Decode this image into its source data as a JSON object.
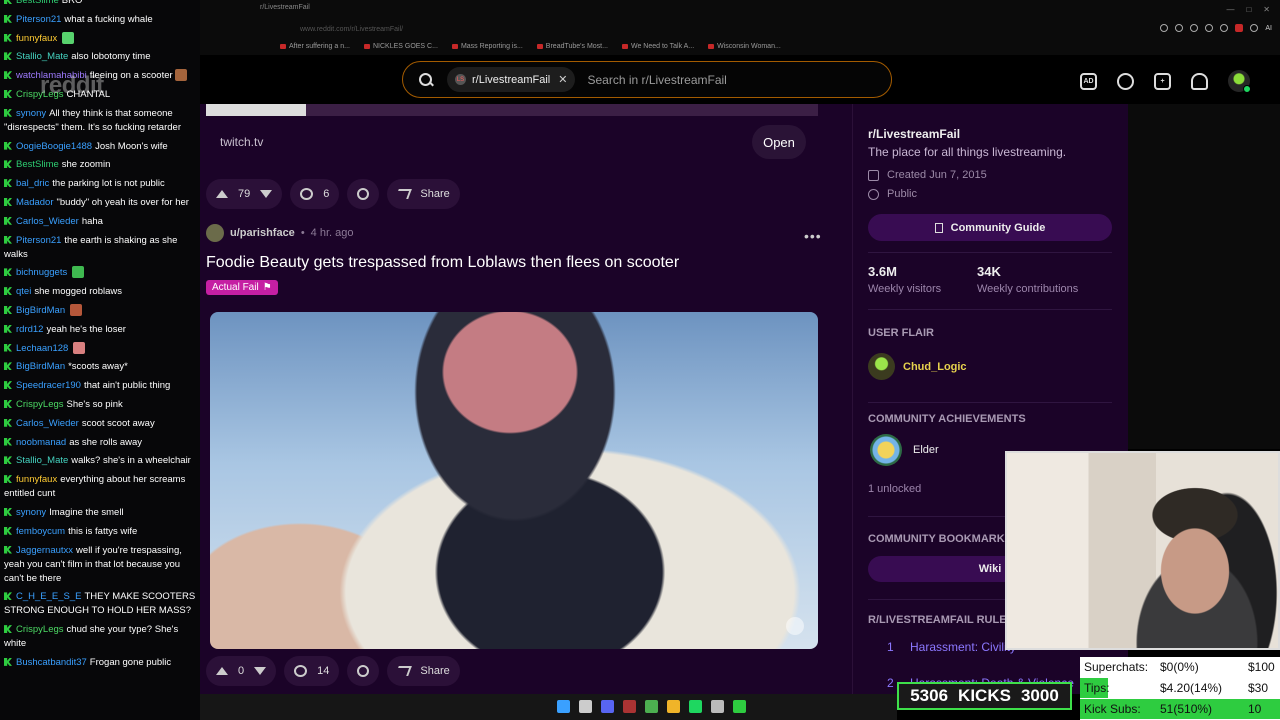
{
  "chat": {
    "messages": [
      {
        "user": "BestSlime",
        "color": "#2ecc71",
        "text": "BRO"
      },
      {
        "user": "Piterson21",
        "color": "#3aa0ff",
        "text": "what a fucking whale"
      },
      {
        "user": "funnyfaux",
        "color": "#ffcc33",
        "text": "",
        "emote": "#58d26e"
      },
      {
        "user": "Stallio_Mate",
        "color": "#45d3c0",
        "text": "also lobotomy time"
      },
      {
        "user": "watchlamahabibi",
        "color": "#9f7bff",
        "text": "fleeing on a scooter",
        "emote": "#a4643c"
      },
      {
        "user": "CrispyLegs",
        "color": "#4cd964",
        "text": "CHANTAL"
      },
      {
        "user": "synony",
        "color": "#3aa0ff",
        "text": "All they think is that someone \"disrespects\" them. It's so fucking retarder"
      },
      {
        "user": "OogieBoogie1488",
        "color": "#3aa0ff",
        "text": "Josh Moon's wife"
      },
      {
        "user": "BestSlime",
        "color": "#2ecc71",
        "text": "she zoomin"
      },
      {
        "user": "bal_dric",
        "color": "#3aa0ff",
        "text": "the parking lot is not public"
      },
      {
        "user": "Madador",
        "color": "#3aa0ff",
        "text": "\"buddy\" oh yeah its over for her"
      },
      {
        "user": "Carlos_Wieder",
        "color": "#3aa0ff",
        "text": "haha"
      },
      {
        "user": "Piterson21",
        "color": "#3aa0ff",
        "text": "the earth is shaking as she walks"
      },
      {
        "user": "bichnuggets",
        "color": "#3aa0ff",
        "text": "",
        "emote": "#3fb950"
      },
      {
        "user": "qtei",
        "color": "#3aa0ff",
        "text": "she mogged roblaws"
      },
      {
        "user": "BigBirdMan",
        "color": "#3aa0ff",
        "text": "",
        "emote": "#b5573a"
      },
      {
        "user": "rdrd12",
        "color": "#3aa0ff",
        "text": "yeah he's the loser"
      },
      {
        "user": "Lechaan128",
        "color": "#3aa0ff",
        "text": "",
        "emote": "#d98080"
      },
      {
        "user": "BigBirdMan",
        "color": "#3aa0ff",
        "text": "*scoots away*"
      },
      {
        "user": "Speedracer190",
        "color": "#3aa0ff",
        "text": "that ain't public thing"
      },
      {
        "user": "CrispyLegs",
        "color": "#4cd964",
        "text": "She's so pink"
      },
      {
        "user": "Carlos_Wieder",
        "color": "#3aa0ff",
        "text": "scoot scoot away"
      },
      {
        "user": "noobmanad",
        "color": "#3aa0ff",
        "text": "as she rolls away"
      },
      {
        "user": "Stallio_Mate",
        "color": "#45d3c0",
        "text": "walks? she's in a wheelchair"
      },
      {
        "user": "funnyfaux",
        "color": "#ffcc33",
        "text": "everything about her screams entitled cunt"
      },
      {
        "user": "synony",
        "color": "#3aa0ff",
        "text": "Imagine the smell"
      },
      {
        "user": "femboycum",
        "color": "#3aa0ff",
        "text": "this is fattys wife"
      },
      {
        "user": "Jaggernautxx",
        "color": "#3aa0ff",
        "text": "well if you're trespassing, yeah you can't film in that lot because you can't be there"
      },
      {
        "user": "C_H_E_E_S_E",
        "color": "#3aa0ff",
        "text": "THEY MAKE SCOOTERS STRONG ENOUGH TO HOLD HER MASS?"
      },
      {
        "user": "CrispyLegs",
        "color": "#4cd964",
        "text": "chud she your type? She's white"
      },
      {
        "user": "Bushcatbandit37",
        "color": "#3aa0ff",
        "text": "Frogan gone public"
      }
    ]
  },
  "browser": {
    "tab_title": "r/LivestreamFail",
    "url": "www.reddit.com/r/LivestreamFail/",
    "bookmarks": [
      "After suffering a n...",
      "NICKLES GOES C...",
      "Mass Reporting is...",
      "BreadTube's Most...",
      "We Need to Talk A...",
      "Wisconsin Woman..."
    ],
    "ext_ai_label": "AI"
  },
  "header": {
    "logo": "reddit",
    "community_chip": "r/LivestreamFail",
    "chip_icon": "LS",
    "search_placeholder": "Search in r/LivestreamFail",
    "icons": [
      "advertise-icon",
      "chat-icon",
      "create-post-icon",
      "notifications-icon"
    ],
    "ad_label": "AD"
  },
  "post1": {
    "link": "twitch.tv",
    "open_label": "Open",
    "votes": "79",
    "comments": "6",
    "share_label": "Share"
  },
  "post2": {
    "author": "u/parishface",
    "time": "4 hr. ago",
    "title": "Foodie Beauty gets trespassed from Loblaws then flees on scooter",
    "flair": "Actual Fail",
    "votes": "0",
    "comments": "14",
    "share_label": "Share"
  },
  "sidebar": {
    "name": "r/LivestreamFail",
    "description": "The place for all things livestreaming.",
    "created": "Created Jun 7, 2015",
    "visibility": "Public",
    "guide_label": "Community Guide",
    "visitors_value": "3.6M",
    "visitors_label": "Weekly visitors",
    "contrib_value": "34K",
    "contrib_label": "Weekly contributions",
    "flair_header": "USER FLAIR",
    "flair_name": "Chud_Logic",
    "achievements_header": "COMMUNITY ACHIEVEMENTS",
    "achievement_name": "Elder",
    "unlocked": "1 unlocked",
    "bookmarks_header": "COMMUNITY BOOKMARKS",
    "wiki_label": "Wiki",
    "rules_header": "R/LIVESTREAMFAIL RULES",
    "rules": [
      {
        "num": "1",
        "text": "Harassment: Civility"
      },
      {
        "num": "2",
        "text": "Harassment: Death & Violence"
      }
    ]
  },
  "overlay": {
    "kicks_count": "5306",
    "kicks_label": "KICKS",
    "kicks_goal": "3000",
    "stats": [
      {
        "label": "Superchats:",
        "value": "$0(0%)",
        "goal": "$100",
        "fraction": 0.0
      },
      {
        "label": "Tips:",
        "value": "$4.20(14%)",
        "goal": "$30",
        "fraction": 0.14
      },
      {
        "label": "Kick Subs:",
        "value": "51(510%)",
        "goal": "10",
        "fraction": 1.0
      }
    ]
  },
  "taskbar": {
    "icons": [
      {
        "name": "windows-start-icon",
        "color": "#3aa0ff"
      },
      {
        "name": "search-icon",
        "color": "#cccccc"
      },
      {
        "name": "discord-icon",
        "color": "#5865f2"
      },
      {
        "name": "obs-icon",
        "color": "#a33"
      },
      {
        "name": "chrome-icon",
        "color": "#4caf50"
      },
      {
        "name": "file-explorer-icon",
        "color": "#f0b429"
      },
      {
        "name": "spotify-icon",
        "color": "#1ed760"
      },
      {
        "name": "terminal-icon",
        "color": "#bbbbbb"
      },
      {
        "name": "xbox-icon",
        "color": "#2ecc40"
      }
    ]
  }
}
